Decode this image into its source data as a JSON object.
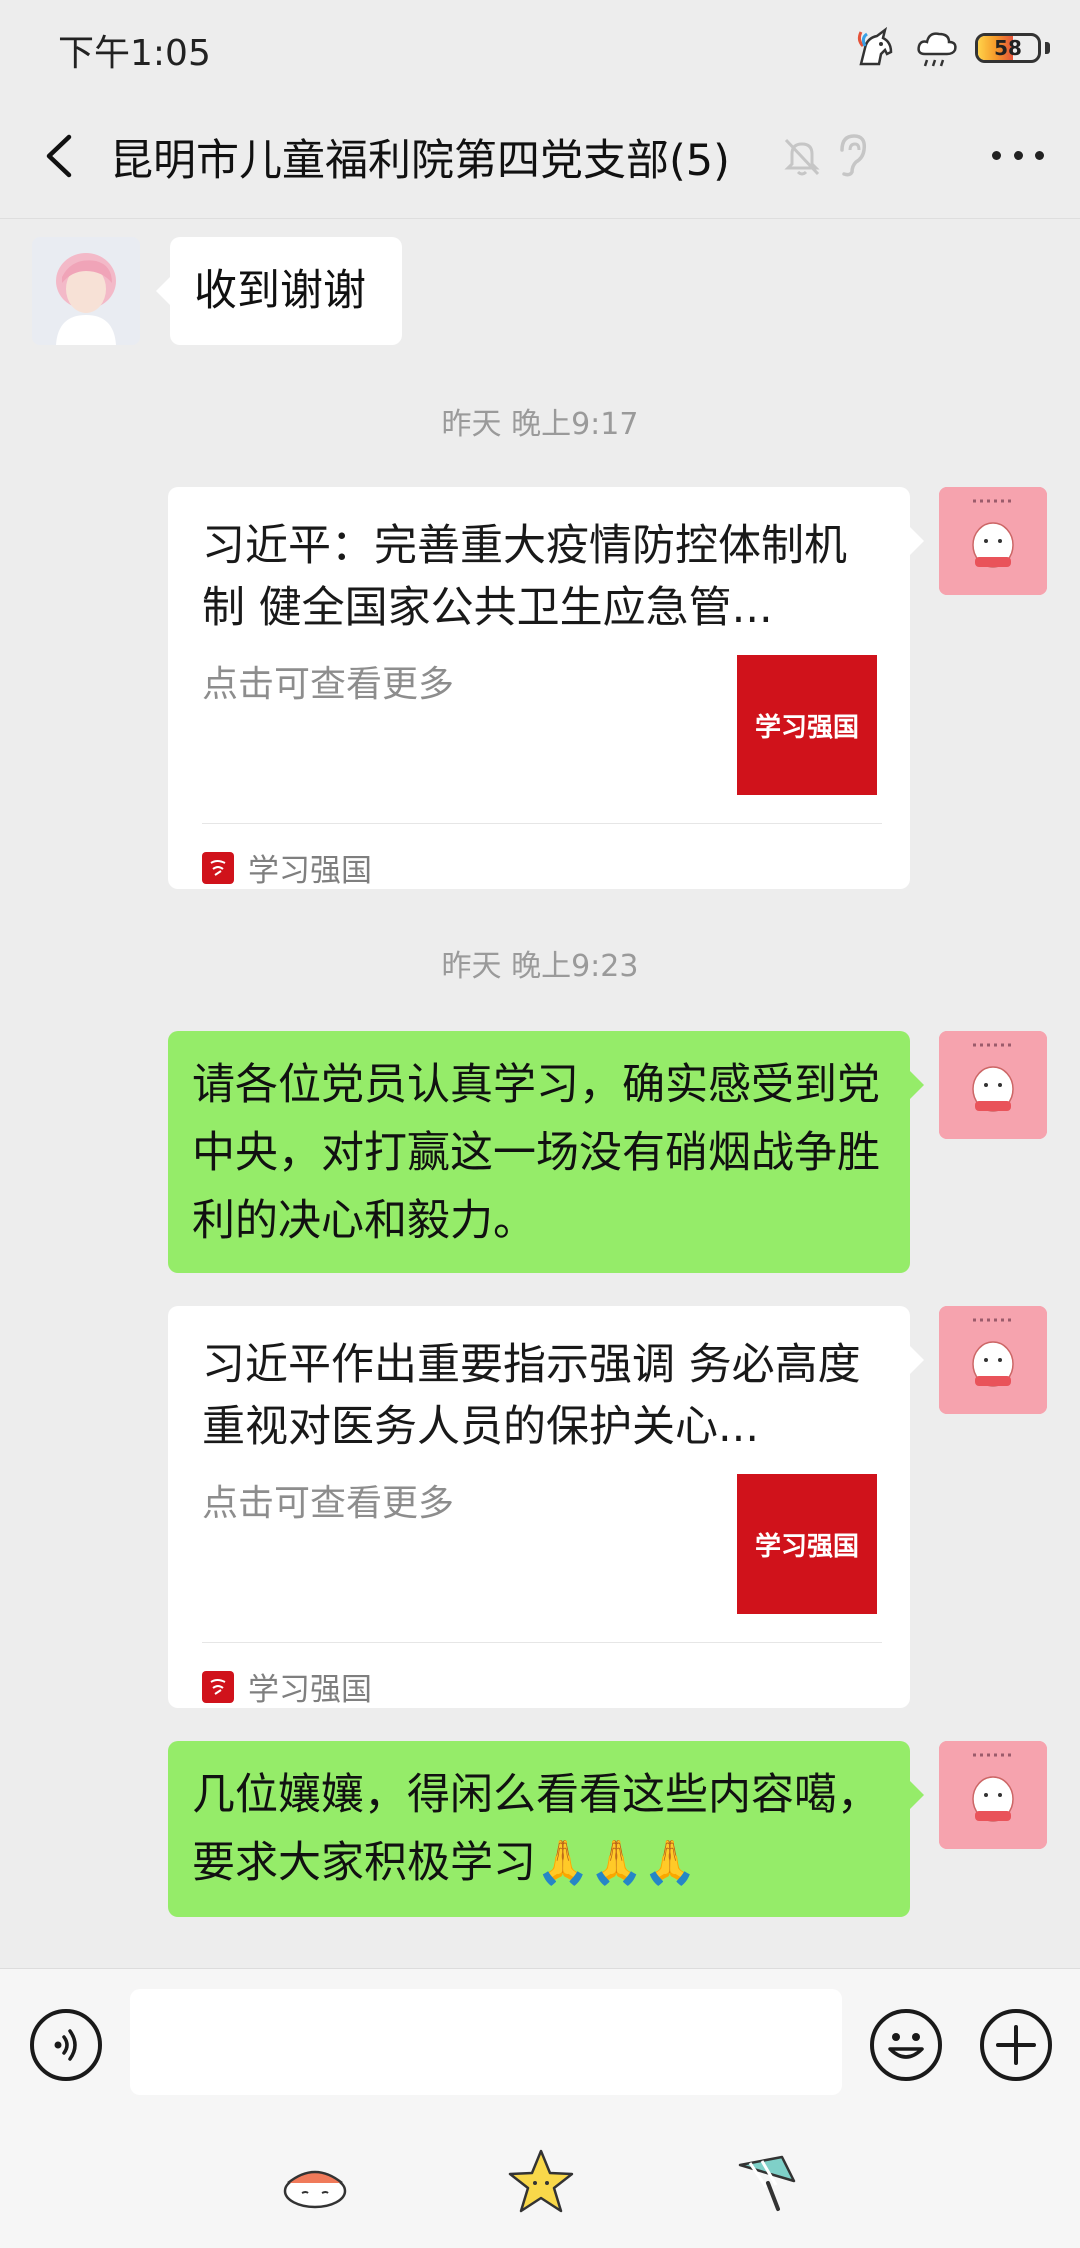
{
  "status_bar": {
    "time": "下午1:05",
    "battery_percent": 58,
    "battery_label": "58",
    "icons": [
      "unicorn-icon",
      "rain-cloud-icon",
      "battery-icon"
    ]
  },
  "header": {
    "title": "昆明市儿童福利院第四党支部(5)",
    "icons": [
      "back-arrow-icon",
      "mute-bell-icon",
      "ear-icon",
      "more-icon"
    ]
  },
  "messages": {
    "m1": {
      "text": "收到谢谢"
    },
    "ts1": "昨天 晚上9:17",
    "m2": {
      "title": "习近平：完善重大疫情防控体制机制 健全国家公共卫生应急管...",
      "desc": "点击可查看更多",
      "source": "学习强国",
      "thumb_text": "学习强国"
    },
    "ts2": "昨天 晚上9:23",
    "m3": {
      "text": "请各位党员认真学习，确实感受到党中央，对打赢这一场没有硝烟战争胜利的决心和毅力。"
    },
    "m4": {
      "title": "习近平作出重要指示强调 务必高度重视对医务人员的保护关心...",
      "desc": "点击可查看更多",
      "source": "学习强国",
      "thumb_text": "学习强国"
    },
    "m5": {
      "text": "几位孃孃，得闲么看看这些内容噶，要求大家积极学习🙏🙏🙏"
    }
  },
  "input_bar": {
    "placeholder": "",
    "icons": [
      "voice-icon",
      "emoji-icon",
      "plus-icon"
    ]
  },
  "sticker_bar": {
    "icons": [
      "sushi-sticker-icon",
      "star-sticker-icon",
      "ice-cream-sticker-icon"
    ]
  },
  "colors": {
    "background": "#ededed",
    "bubble_self": "#95ec69",
    "bubble_other": "#ffffff",
    "xuexi_red": "#d0121b"
  }
}
